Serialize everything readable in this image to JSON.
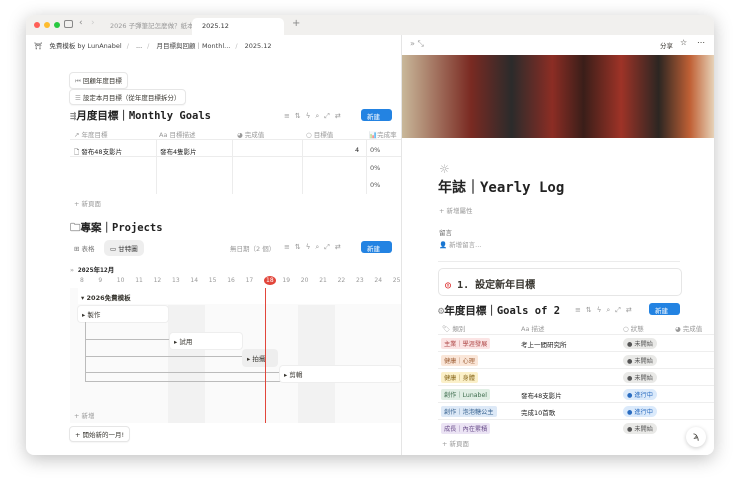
{
  "window": {
    "tabs": [
      "2026 子彈筆記怎麼做？紙本",
      "2025.12"
    ],
    "new_tab": "+"
  },
  "breadcrumb": [
    "免費模板 by LunAnabel",
    "...",
    "月目標與回顧｜Monthl...",
    "2025.12"
  ],
  "left": {
    "buttons": {
      "review": "回顧年度目標",
      "set_month": "設定本月目標（從年度目標拆分）"
    },
    "monthly": {
      "title": "月度目標｜Monthly Goals",
      "new": "新建",
      "columns": [
        "年度目標",
        "目標描述",
        "完成值",
        "目標值",
        "完成率"
      ],
      "rows": [
        {
          "yearly": "發布48支影片",
          "desc": "發布4隻影片",
          "done": "",
          "target": "4",
          "rate": "0%"
        },
        {
          "yearly": "",
          "desc": "",
          "done": "",
          "target": "",
          "rate": "0%"
        },
        {
          "yearly": "",
          "desc": "",
          "done": "",
          "target": "",
          "rate": "0%"
        }
      ],
      "add": "新頁面"
    },
    "projects": {
      "title": "專案｜Projects",
      "views": [
        "表格",
        "甘特圖"
      ],
      "no_date": "無日期（2 個）",
      "new": "新建",
      "month": "2025年12月",
      "days": [
        "8",
        "9",
        "10",
        "11",
        "12",
        "13",
        "14",
        "15",
        "16",
        "17",
        "18",
        "19",
        "20",
        "21",
        "22",
        "23",
        "24",
        "25"
      ],
      "today": "18",
      "group": "2026免費模板",
      "items": [
        "製作",
        "試用",
        "拍攝",
        "剪輯"
      ],
      "add": "新增"
    },
    "start_month": "開始新的一月!"
  },
  "right": {
    "share": "分享",
    "title": "年誌｜Yearly Log",
    "add_property": "新增屬性",
    "comments_label": "留言",
    "comment_placeholder": "新增留言...",
    "section": "1. 設定新年目標",
    "goals": {
      "title": "年度目標｜Goals of 2",
      "new": "新建",
      "columns": [
        "類別",
        "描述",
        "狀態",
        "完成值"
      ],
      "rows": [
        {
          "cat": "主業｜學涯發展",
          "color": "#fbe4e4",
          "fg": "#b04a4a",
          "desc": "考上一間研究所",
          "status": "未開始"
        },
        {
          "cat": "健康｜心理",
          "color": "#fae6d8",
          "fg": "#a0623a",
          "desc": "",
          "status": "未開始"
        },
        {
          "cat": "健康｜身體",
          "color": "#fbf0c9",
          "fg": "#8a6a1e",
          "desc": "",
          "status": "未開始"
        },
        {
          "cat": "創作｜Lunabel",
          "color": "#e0eee4",
          "fg": "#3f6e4f",
          "desc": "發布48支影片",
          "status": "進行中"
        },
        {
          "cat": "創作｜泡泡糖公主",
          "color": "#dde9f7",
          "fg": "#3a6592",
          "desc": "完成10首歌",
          "status": "進行中"
        },
        {
          "cat": "成長｜內在累積",
          "color": "#ebe3f4",
          "fg": "#6b4f8c",
          "desc": "",
          "status": "未開始"
        }
      ],
      "add": "新頁面"
    }
  },
  "colors": {
    "accent": "#2383e2",
    "today": "#e2463b"
  }
}
